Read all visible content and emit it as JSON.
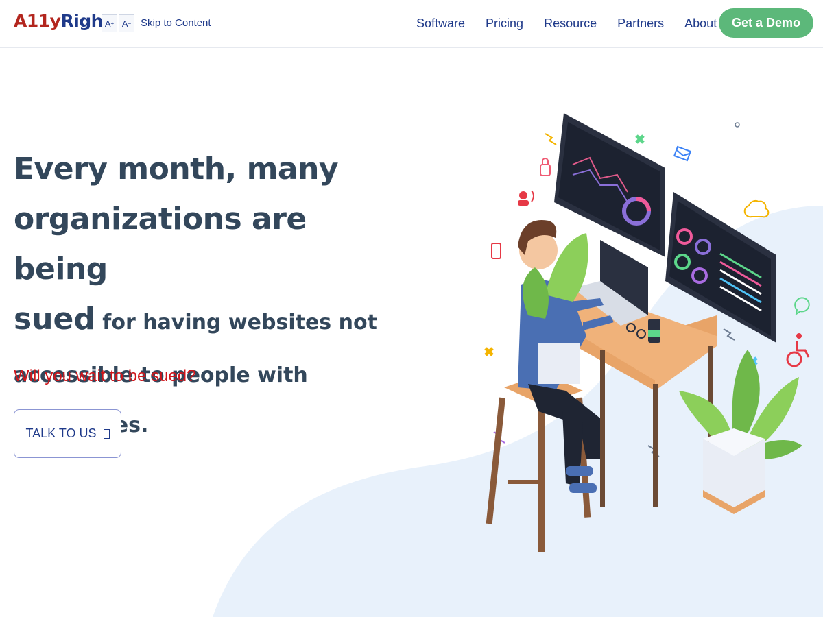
{
  "header": {
    "logo_a11y": "A11y",
    "logo_right": "Right",
    "font_increase": "A",
    "font_increase_sup": "+",
    "font_decrease": "A",
    "font_decrease_sup": "−",
    "skip_link": "Skip to Content",
    "nav": [
      "Software",
      "Pricing",
      "Resource",
      "Partners",
      "About"
    ],
    "demo_button": "Get a Demo"
  },
  "hero": {
    "line1": "Every month, many",
    "line2": "organizations are being",
    "line3_big": "sued",
    "line3_small": " for having websites not",
    "line4": "accessible to people with disabilities.",
    "question": "Will you wait to be sued?",
    "cta": "TALK TO US"
  },
  "colors": {
    "brand_red": "#b3261e",
    "brand_blue": "#1f3a8a",
    "demo_green": "#5cb87a",
    "question_red": "#d0161b"
  }
}
